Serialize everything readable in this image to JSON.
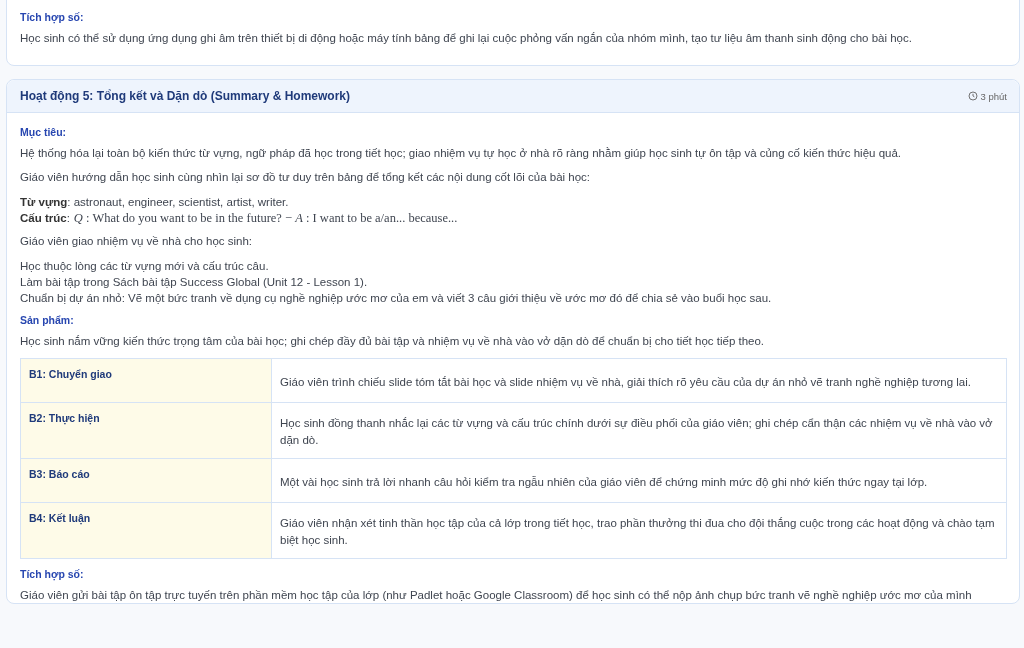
{
  "prev_card": {
    "sections": [
      {
        "label": "Tích hợp số:",
        "paragraphs": [
          "Học sinh có thể sử dụng ứng dụng ghi âm trên thiết bị di động hoặc máy tính bảng để ghi lại cuộc phỏng vấn ngắn của nhóm mình, tạo tư liệu âm thanh sinh động cho bài học."
        ]
      }
    ]
  },
  "activity": {
    "title": "Hoạt động 5: Tổng kết và Dặn dò (Summary & Homework)",
    "duration": "3 phút",
    "goal": {
      "label": "Mục tiêu:",
      "text": "Hệ thống hóa lại toàn bộ kiến thức từ vựng, ngữ pháp đã học trong tiết học; giao nhiệm vụ tự học ở nhà rõ ràng nhằm giúp học sinh tự ôn tập và củng cố kiến thức hiệu quả."
    },
    "content": [
      {
        "kind": "para",
        "text": "Giáo viên hướng dẫn học sinh cùng nhìn lại sơ đồ tư duy trên bảng để tổng kết các nội dung cốt lõi của bài học:"
      },
      {
        "kind": "lines",
        "lines": [
          {
            "text": "**Từ vựng**: astronaut, engineer, scientist, artist, writer."
          },
          {
            "text": "**Cấu trúc**:",
            "formula": "*Q* : What do you want to be in the future? − *A* : I want to be a/an... because..."
          }
        ]
      },
      {
        "kind": "para",
        "text": "Giáo viên giao nhiệm vụ về nhà cho học sinh:"
      },
      {
        "kind": "lines",
        "lines": [
          {
            "text": "Học thuộc lòng các từ vựng mới và cấu trúc câu."
          },
          {
            "text": "Làm bài tập trong Sách bài tập Success Global (Unit 12 - Lesson 1)."
          },
          {
            "text": "Chuẩn bị dự án nhỏ: Vẽ một bức tranh về dụng cụ nghề nghiệp ước mơ của em và viết 3 câu giới thiệu về ước mơ đó để chia sẻ vào buổi học sau."
          }
        ]
      }
    ],
    "product": {
      "label": "Sản phẩm:",
      "text": "Học sinh nắm vững kiến thức trọng tâm của bài học; ghi chép đầy đủ bài tập và nhiệm vụ về nhà vào vở dặn dò để chuẩn bị cho tiết học tiếp theo."
    },
    "steps": [
      {
        "step": "B1: Chuyển giao",
        "text": "Giáo viên trình chiếu slide tóm tắt bài học và slide nhiệm vụ về nhà, giải thích rõ yêu cầu của dự án nhỏ vẽ tranh nghề nghiệp tương lai."
      },
      {
        "step": "B2: Thực hiện",
        "text": "Học sinh đồng thanh nhắc lại các từ vựng và cấu trúc chính dưới sự điều phối của giáo viên; ghi chép cẩn thận các nhiệm vụ về nhà vào vở dặn dò."
      },
      {
        "step": "B3: Báo cáo",
        "text": "Một vài học sinh trả lời nhanh câu hỏi kiểm tra ngẫu nhiên của giáo viên để chứng minh mức độ ghi nhớ kiến thức ngay tại lớp."
      },
      {
        "step": "B4: Kết luận",
        "text": "Giáo viên nhận xét tinh thần học tập của cả lớp trong tiết học, trao phần thưởng thi đua cho đội thắng cuộc trong các hoạt động và chào tạm biệt học sinh."
      }
    ],
    "digital": {
      "label": "Tích hợp số:",
      "text": "Giáo viên gửi bài tập ôn tập trực tuyến trên phần mềm học tập của lớp (như Padlet hoặc Google Classroom) để học sinh có thể nộp ảnh chụp bức tranh vẽ nghề nghiệp ước mơ của mình"
    }
  }
}
